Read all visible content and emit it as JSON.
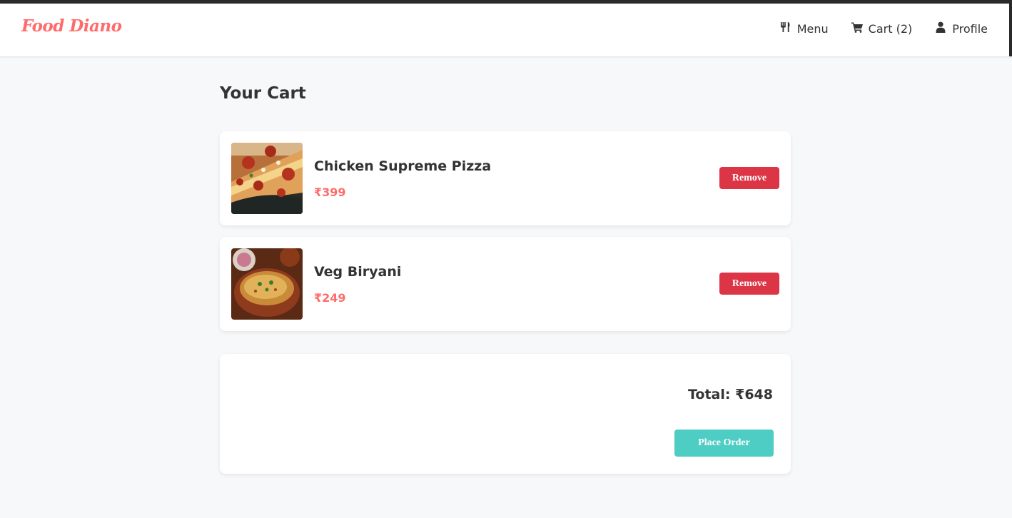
{
  "brand": {
    "name": "Food Diano",
    "color": "#ff6b6b"
  },
  "nav": {
    "menu": {
      "label": "Menu",
      "icon": "utensils-icon"
    },
    "cart": {
      "label": "Cart (2)",
      "icon": "cart-icon"
    },
    "profile": {
      "label": "Profile",
      "icon": "user-icon"
    }
  },
  "page": {
    "title": "Your Cart"
  },
  "cart": {
    "items": [
      {
        "name": "Chicken Supreme Pizza",
        "price": "₹399",
        "image": "pizza-image",
        "remove_label": "Remove"
      },
      {
        "name": "Veg Biryani",
        "price": "₹249",
        "image": "biryani-image",
        "remove_label": "Remove"
      }
    ]
  },
  "summary": {
    "total": "Total: ₹648",
    "place_order_label": "Place Order"
  },
  "colors": {
    "accent": "#ff6b6b",
    "remove": "#dc3545",
    "place_order": "#4ecdc4",
    "background": "#f7f8fa"
  }
}
